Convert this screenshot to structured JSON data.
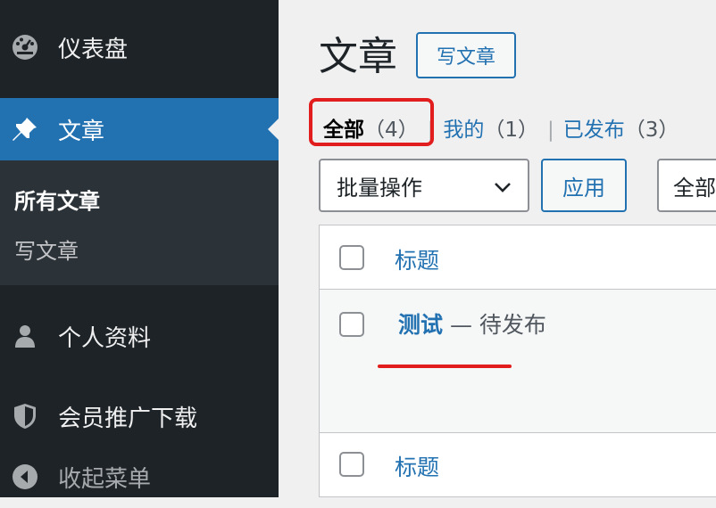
{
  "sidebar": {
    "dashboard": {
      "label": "仪表盘",
      "icon": "dashboard-icon"
    },
    "posts": {
      "label": "文章",
      "icon": "pushpin-icon"
    },
    "submenu": {
      "all_posts": "所有文章",
      "add_new": "写文章"
    },
    "profile": {
      "label": "个人资料",
      "icon": "user-icon"
    },
    "membership": {
      "label": "会员推广下载",
      "icon": "shield-icon"
    },
    "collapse": {
      "label": "收起菜单",
      "icon": "collapse-arrow-icon"
    }
  },
  "main": {
    "title": "文章",
    "add_new_button": "写文章",
    "views": [
      {
        "label": "全部",
        "count": "（4）"
      },
      {
        "label": "我的",
        "count": "（1）"
      },
      {
        "label": "已发布",
        "count": "（3）"
      }
    ],
    "separator": "|",
    "bulk_actions": {
      "selected": "批量操作"
    },
    "apply_button": "应用",
    "date_filter": {
      "selected": "全部"
    },
    "table": {
      "header_title": "标题",
      "footer_title": "标题",
      "rows": [
        {
          "title": "测试",
          "state": "— 待发布"
        }
      ]
    }
  },
  "colors": {
    "sidebar_bg": "#1d2327",
    "active_bg": "#2271b1",
    "link": "#2271b1",
    "annotation_red": "#e11d1d"
  }
}
